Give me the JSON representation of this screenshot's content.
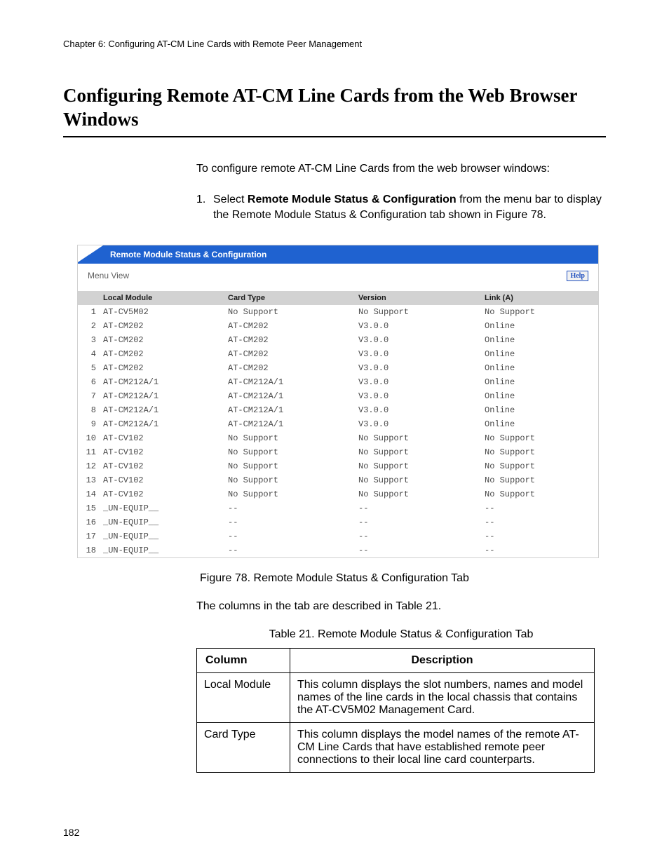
{
  "header": {
    "chapterLine": "Chapter 6: Configuring AT-CM Line Cards with Remote Peer Management",
    "title": "Configuring Remote AT-CM Line Cards from the Web Browser Windows"
  },
  "intro": "To configure remote AT-CM Line Cards from the web browser windows:",
  "step1": {
    "num": "1.",
    "prefix": "Select ",
    "bold": "Remote Module Status & Configuration",
    "suffix": " from the menu bar to display the Remote Module Status & Configuration tab shown in Figure 78."
  },
  "screenshot": {
    "titlebar": "Remote Module Status & Configuration",
    "menuView": "Menu View",
    "help": "Help",
    "headers": [
      "",
      "Local Module",
      "Card Type",
      "Version",
      "Link (A)"
    ],
    "rows": [
      [
        "1",
        "AT-CV5M02",
        "No Support",
        "No Support",
        "No Support"
      ],
      [
        "2",
        "AT-CM202",
        "AT-CM202",
        "V3.0.0",
        "Online"
      ],
      [
        "3",
        "AT-CM202",
        "AT-CM202",
        "V3.0.0",
        "Online"
      ],
      [
        "4",
        "AT-CM202",
        "AT-CM202",
        "V3.0.0",
        "Online"
      ],
      [
        "5",
        "AT-CM202",
        "AT-CM202",
        "V3.0.0",
        "Online"
      ],
      [
        "6",
        "AT-CM212A/1",
        "AT-CM212A/1",
        "V3.0.0",
        "Online"
      ],
      [
        "7",
        "AT-CM212A/1",
        "AT-CM212A/1",
        "V3.0.0",
        "Online"
      ],
      [
        "8",
        "AT-CM212A/1",
        "AT-CM212A/1",
        "V3.0.0",
        "Online"
      ],
      [
        "9",
        "AT-CM212A/1",
        "AT-CM212A/1",
        "V3.0.0",
        "Online"
      ],
      [
        "10",
        "AT-CV102",
        "No Support",
        "No Support",
        "No Support"
      ],
      [
        "11",
        "AT-CV102",
        "No Support",
        "No Support",
        "No Support"
      ],
      [
        "12",
        "AT-CV102",
        "No Support",
        "No Support",
        "No Support"
      ],
      [
        "13",
        "AT-CV102",
        "No Support",
        "No Support",
        "No Support"
      ],
      [
        "14",
        "AT-CV102",
        "No Support",
        "No Support",
        "No Support"
      ],
      [
        "15",
        "_UN-EQUIP__",
        "--",
        "--",
        "--"
      ],
      [
        "16",
        "_UN-EQUIP__",
        "--",
        "--",
        "--"
      ],
      [
        "17",
        "_UN-EQUIP__",
        "--",
        "--",
        "--"
      ],
      [
        "18",
        "_UN-EQUIP__",
        "--",
        "--",
        "--"
      ]
    ]
  },
  "figCaption": "Figure 78. Remote Module Status & Configuration Tab",
  "descP": "The columns in the tab are described in Table 21.",
  "tblCaption": "Table 21. Remote Module Status & Configuration Tab",
  "table21": {
    "headers": [
      "Column",
      "Description"
    ],
    "rows": [
      [
        "Local Module",
        "This column displays the slot numbers, names and model names of the line cards in the local chassis that contains the AT-CV5M02 Management Card."
      ],
      [
        "Card Type",
        "This column displays the model names of the remote AT-CM Line Cards that have established remote peer connections to their local line card counterparts."
      ]
    ]
  },
  "pageNum": "182"
}
